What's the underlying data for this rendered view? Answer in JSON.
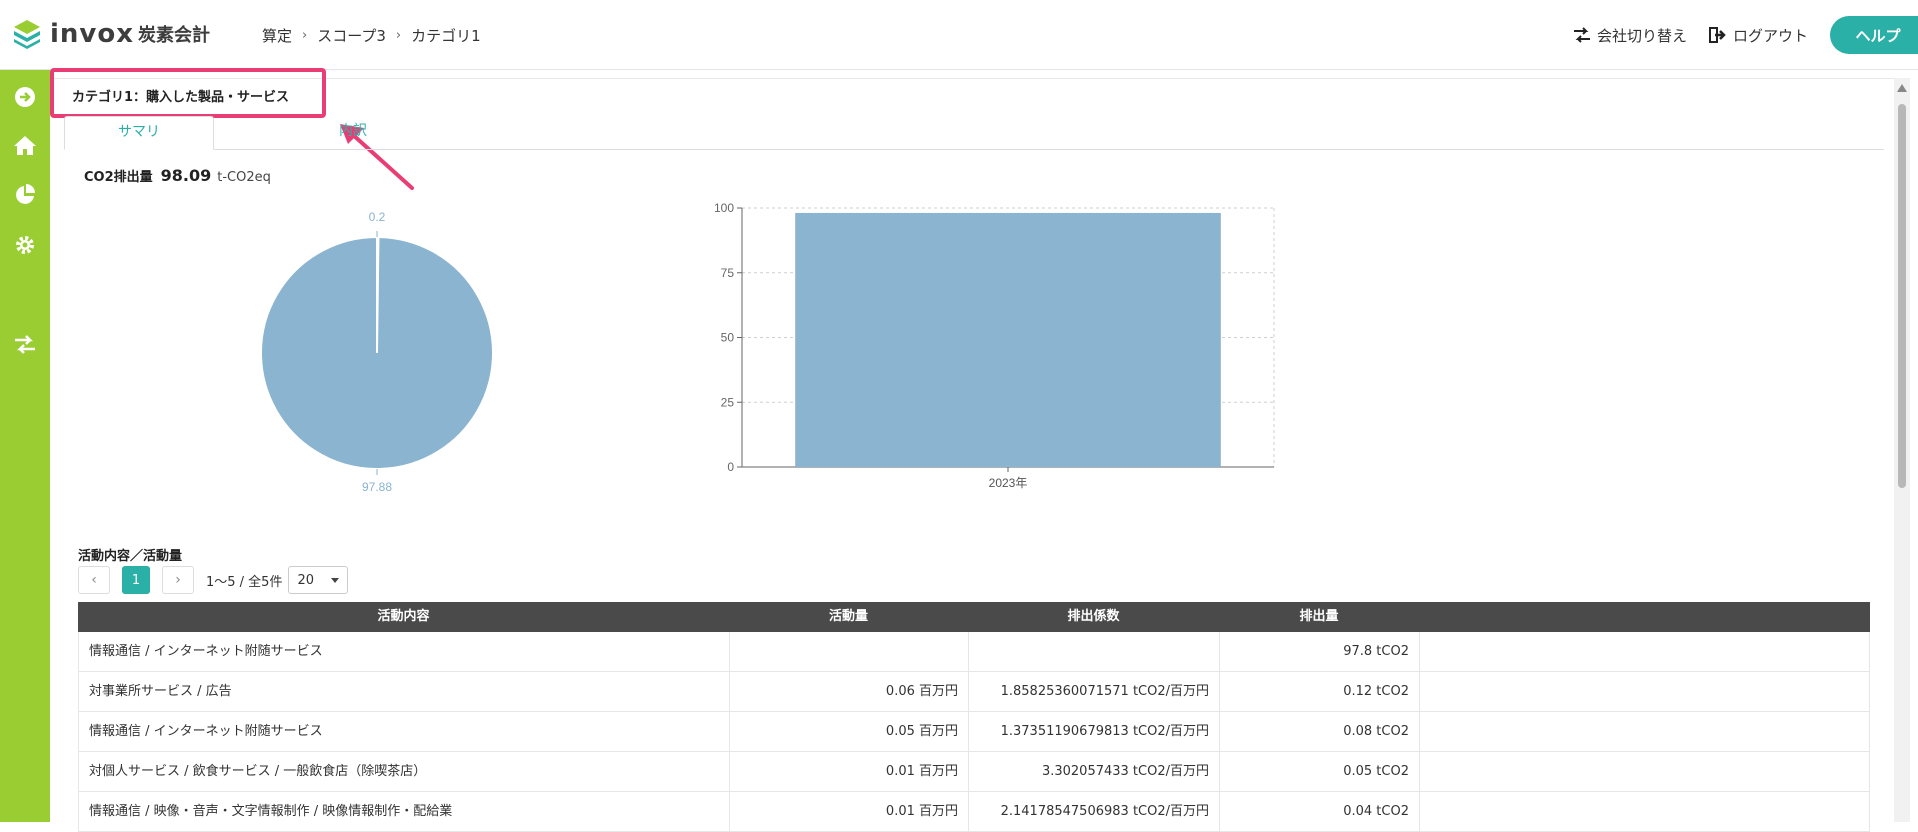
{
  "header": {
    "logo_text": "invox",
    "logo_sub": "炭素会計",
    "breadcrumb": [
      "算定",
      "スコープ3",
      "カテゴリ1"
    ],
    "switch_company": "会社切り替え",
    "logout": "ログアウト",
    "help": "ヘルプ"
  },
  "sidebar": {
    "items": [
      "arrow-circle-icon",
      "home-icon",
      "pie-chart-icon",
      "gear-icon",
      "switch-icon"
    ]
  },
  "page": {
    "title": "カテゴリ1：購入した製品・サービス",
    "tabs": [
      "サマリ",
      "内訳"
    ],
    "co2_label": "CO2排出量",
    "co2_value": "98.09",
    "co2_unit": "t-CO2eq"
  },
  "chart_data": [
    {
      "type": "pie",
      "labels": [
        "0.2",
        "97.88"
      ],
      "values": [
        0.2,
        97.88
      ],
      "colors": [
        "#8ab4d0",
        "#8ab4d0"
      ]
    },
    {
      "type": "bar",
      "categories": [
        "2023年"
      ],
      "values": [
        98.09
      ],
      "ylim": [
        0,
        100
      ],
      "yticks": [
        0,
        25,
        50,
        75,
        100
      ],
      "color": "#8ab4d0",
      "grid": true
    }
  ],
  "activities": {
    "title": "活動内容／活動量",
    "page_current": "1",
    "range_info": "1〜5 / 全5件",
    "page_size": "20",
    "columns": [
      "活動内容",
      "活動量",
      "排出係数",
      "排出量"
    ],
    "rows": [
      [
        "情報通信 / インターネット附随サービス",
        "",
        "",
        "97.8 tCO2"
      ],
      [
        "対事業所サービス / 広告",
        "0.06 百万円",
        "1.85825360071571 tCO2/百万円",
        "0.12 tCO2"
      ],
      [
        "情報通信 / インターネット附随サービス",
        "0.05 百万円",
        "1.37351190679813 tCO2/百万円",
        "0.08 tCO2"
      ],
      [
        "対個人サービス / 飲食サービス / 一般飲食店（除喫茶店）",
        "0.01 百万円",
        "3.302057433 tCO2/百万円",
        "0.05 tCO2"
      ],
      [
        "情報通信 / 映像・音声・文字情報制作 / 映像情報制作・配給業",
        "0.01 百万円",
        "2.14178547506983 tCO2/百万円",
        "0.04 tCO2"
      ]
    ]
  },
  "colors": {
    "accent": "#2bb0a8",
    "sidebar": "#9acd32",
    "highlight": "#e83e75",
    "chart": "#8ab4d0"
  }
}
